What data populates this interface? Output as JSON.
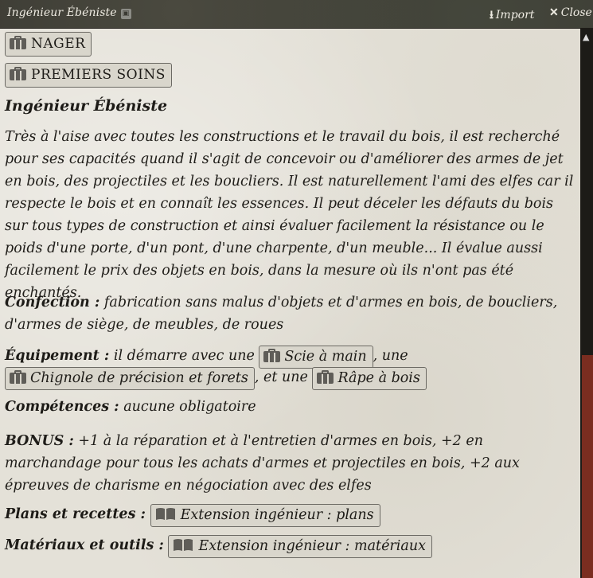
{
  "window": {
    "title": "Ingénieur Ébéniste",
    "import_label": "Import",
    "close_label": "Close"
  },
  "skills": [
    {
      "label": "NAGER",
      "icon": "briefcase-icon"
    },
    {
      "label": "PREMIERS SOINS",
      "icon": "briefcase-icon"
    }
  ],
  "journal": {
    "heading": "Ingénieur Ébéniste",
    "description": "Très à l'aise avec toutes les constructions et le travail du bois, il est recherché pour ses capacités quand il s'agit de concevoir ou d'améliorer des armes de jet en bois, des projectiles et les boucliers. Il est naturellement l'ami des elfes car il respecte le bois et en connaît les essences. Il peut déceler les défauts du bois sur tous types de construction et ainsi évaluer facilement la résistance ou le poids d'une porte, d'un pont, d'une charpente, d'un meuble... Il évalue aussi facilement le prix des objets en bois, dans la mesure où ils n'ont pas été enchantés.",
    "confection_label": "Confection :",
    "confection_text": "fabrication sans malus d'objets et d'armes en bois, de boucliers, d'armes de siège, de meubles, de roues",
    "equipement_label": "Équipement :",
    "equipement_prefix": "il démarre avec une",
    "equipement_item1": "Scie à main",
    "equipement_sep1": ", une",
    "equipement_item2": "Chignole de précision et forets",
    "equipement_sep2": ", et une",
    "equipement_item3": "Râpe à bois",
    "competences_label": "Compétences :",
    "competences_text": "aucune obligatoire",
    "bonus_label": "BONUS :",
    "bonus_text": "+1 à la réparation et à l'entretien d'armes en bois, +2 en marchandage pour tous les achats d'armes et projectiles en bois, +2 aux épreuves de charisme en négociation avec des elfes",
    "plans_label": "Plans et recettes :",
    "plans_link": "Extension ingénieur : plans",
    "materiaux_label": "Matériaux et outils :",
    "materiaux_link": "Extension ingénieur : matériaux"
  },
  "colors": {
    "titlebar": "#3b3a33",
    "parchment": "#e4e1d8",
    "scroll_highlight": "#7a2d20"
  }
}
